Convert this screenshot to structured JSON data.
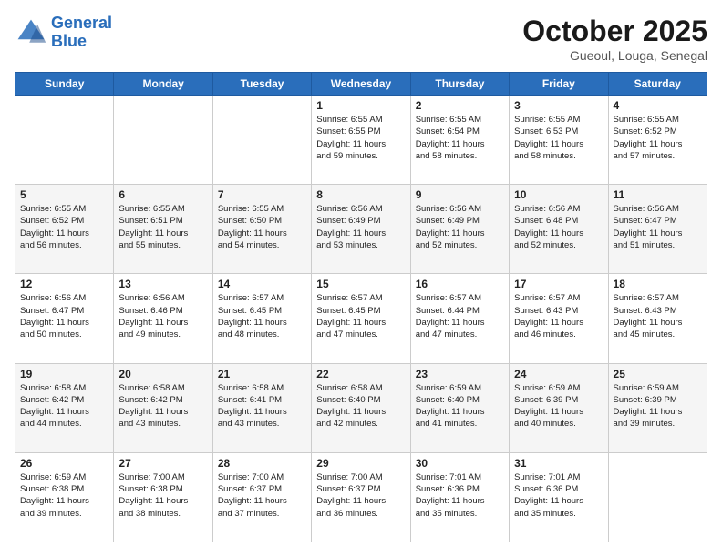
{
  "logo": {
    "line1": "General",
    "line2": "Blue"
  },
  "title": "October 2025",
  "subtitle": "Gueoul, Louga, Senegal",
  "days_header": [
    "Sunday",
    "Monday",
    "Tuesday",
    "Wednesday",
    "Thursday",
    "Friday",
    "Saturday"
  ],
  "weeks": [
    [
      {
        "day": "",
        "info": ""
      },
      {
        "day": "",
        "info": ""
      },
      {
        "day": "",
        "info": ""
      },
      {
        "day": "1",
        "info": "Sunrise: 6:55 AM\nSunset: 6:55 PM\nDaylight: 11 hours\nand 59 minutes."
      },
      {
        "day": "2",
        "info": "Sunrise: 6:55 AM\nSunset: 6:54 PM\nDaylight: 11 hours\nand 58 minutes."
      },
      {
        "day": "3",
        "info": "Sunrise: 6:55 AM\nSunset: 6:53 PM\nDaylight: 11 hours\nand 58 minutes."
      },
      {
        "day": "4",
        "info": "Sunrise: 6:55 AM\nSunset: 6:52 PM\nDaylight: 11 hours\nand 57 minutes."
      }
    ],
    [
      {
        "day": "5",
        "info": "Sunrise: 6:55 AM\nSunset: 6:52 PM\nDaylight: 11 hours\nand 56 minutes."
      },
      {
        "day": "6",
        "info": "Sunrise: 6:55 AM\nSunset: 6:51 PM\nDaylight: 11 hours\nand 55 minutes."
      },
      {
        "day": "7",
        "info": "Sunrise: 6:55 AM\nSunset: 6:50 PM\nDaylight: 11 hours\nand 54 minutes."
      },
      {
        "day": "8",
        "info": "Sunrise: 6:56 AM\nSunset: 6:49 PM\nDaylight: 11 hours\nand 53 minutes."
      },
      {
        "day": "9",
        "info": "Sunrise: 6:56 AM\nSunset: 6:49 PM\nDaylight: 11 hours\nand 52 minutes."
      },
      {
        "day": "10",
        "info": "Sunrise: 6:56 AM\nSunset: 6:48 PM\nDaylight: 11 hours\nand 52 minutes."
      },
      {
        "day": "11",
        "info": "Sunrise: 6:56 AM\nSunset: 6:47 PM\nDaylight: 11 hours\nand 51 minutes."
      }
    ],
    [
      {
        "day": "12",
        "info": "Sunrise: 6:56 AM\nSunset: 6:47 PM\nDaylight: 11 hours\nand 50 minutes."
      },
      {
        "day": "13",
        "info": "Sunrise: 6:56 AM\nSunset: 6:46 PM\nDaylight: 11 hours\nand 49 minutes."
      },
      {
        "day": "14",
        "info": "Sunrise: 6:57 AM\nSunset: 6:45 PM\nDaylight: 11 hours\nand 48 minutes."
      },
      {
        "day": "15",
        "info": "Sunrise: 6:57 AM\nSunset: 6:45 PM\nDaylight: 11 hours\nand 47 minutes."
      },
      {
        "day": "16",
        "info": "Sunrise: 6:57 AM\nSunset: 6:44 PM\nDaylight: 11 hours\nand 47 minutes."
      },
      {
        "day": "17",
        "info": "Sunrise: 6:57 AM\nSunset: 6:43 PM\nDaylight: 11 hours\nand 46 minutes."
      },
      {
        "day": "18",
        "info": "Sunrise: 6:57 AM\nSunset: 6:43 PM\nDaylight: 11 hours\nand 45 minutes."
      }
    ],
    [
      {
        "day": "19",
        "info": "Sunrise: 6:58 AM\nSunset: 6:42 PM\nDaylight: 11 hours\nand 44 minutes."
      },
      {
        "day": "20",
        "info": "Sunrise: 6:58 AM\nSunset: 6:42 PM\nDaylight: 11 hours\nand 43 minutes."
      },
      {
        "day": "21",
        "info": "Sunrise: 6:58 AM\nSunset: 6:41 PM\nDaylight: 11 hours\nand 43 minutes."
      },
      {
        "day": "22",
        "info": "Sunrise: 6:58 AM\nSunset: 6:40 PM\nDaylight: 11 hours\nand 42 minutes."
      },
      {
        "day": "23",
        "info": "Sunrise: 6:59 AM\nSunset: 6:40 PM\nDaylight: 11 hours\nand 41 minutes."
      },
      {
        "day": "24",
        "info": "Sunrise: 6:59 AM\nSunset: 6:39 PM\nDaylight: 11 hours\nand 40 minutes."
      },
      {
        "day": "25",
        "info": "Sunrise: 6:59 AM\nSunset: 6:39 PM\nDaylight: 11 hours\nand 39 minutes."
      }
    ],
    [
      {
        "day": "26",
        "info": "Sunrise: 6:59 AM\nSunset: 6:38 PM\nDaylight: 11 hours\nand 39 minutes."
      },
      {
        "day": "27",
        "info": "Sunrise: 7:00 AM\nSunset: 6:38 PM\nDaylight: 11 hours\nand 38 minutes."
      },
      {
        "day": "28",
        "info": "Sunrise: 7:00 AM\nSunset: 6:37 PM\nDaylight: 11 hours\nand 37 minutes."
      },
      {
        "day": "29",
        "info": "Sunrise: 7:00 AM\nSunset: 6:37 PM\nDaylight: 11 hours\nand 36 minutes."
      },
      {
        "day": "30",
        "info": "Sunrise: 7:01 AM\nSunset: 6:36 PM\nDaylight: 11 hours\nand 35 minutes."
      },
      {
        "day": "31",
        "info": "Sunrise: 7:01 AM\nSunset: 6:36 PM\nDaylight: 11 hours\nand 35 minutes."
      },
      {
        "day": "",
        "info": ""
      }
    ]
  ]
}
